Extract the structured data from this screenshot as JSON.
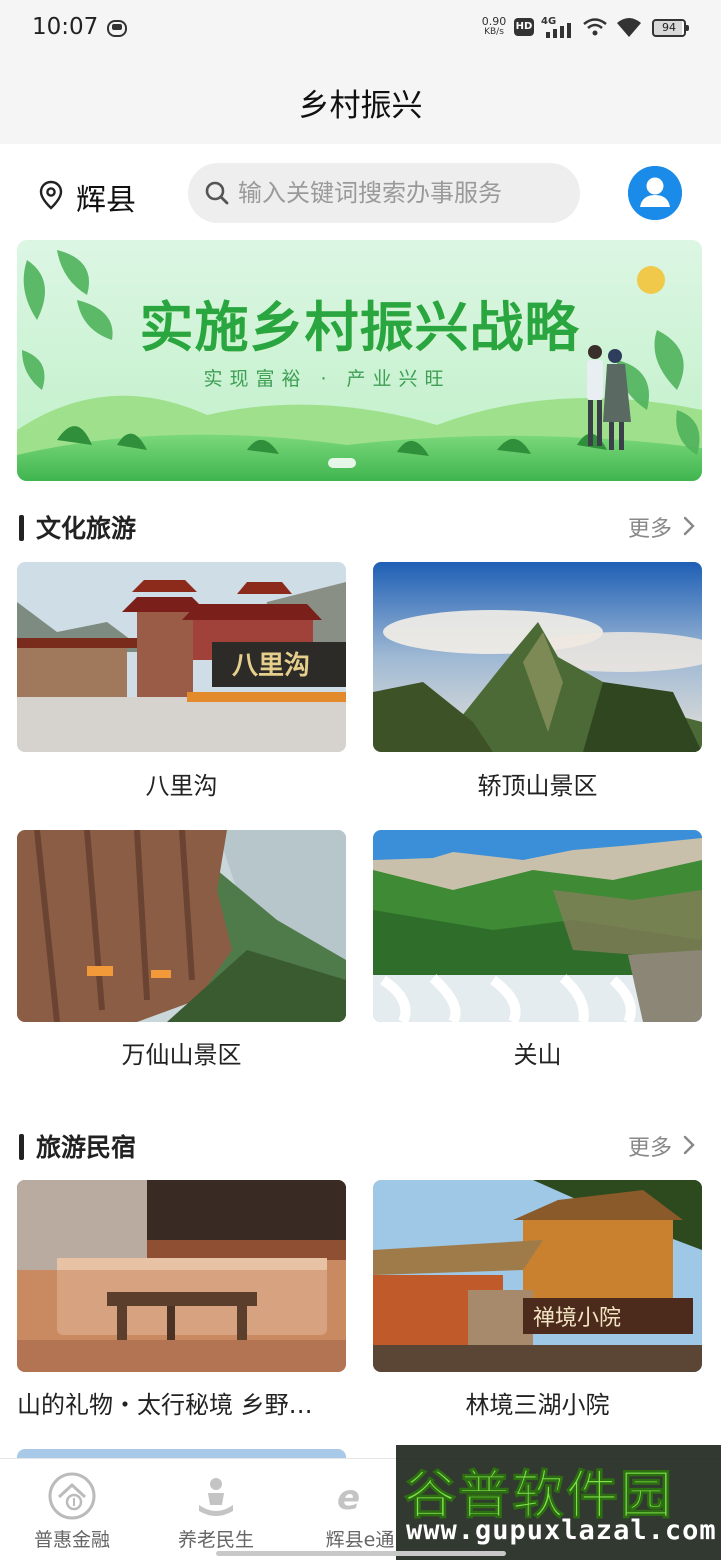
{
  "status": {
    "time": "10:07",
    "speed_value": "0.90",
    "speed_unit": "KB/s",
    "hd": "HD",
    "network": "4G",
    "battery": "94"
  },
  "header": {
    "title": "乡村振兴"
  },
  "location": {
    "city": "辉县"
  },
  "search": {
    "placeholder": "输入关键词搜索办事服务",
    "value": ""
  },
  "banner": {
    "title": "实施乡村振兴战略",
    "subtitle": "实现富裕 · 产业兴旺"
  },
  "sections": [
    {
      "title": "文化旅游",
      "more": "更多",
      "items": [
        {
          "label": "八里沟"
        },
        {
          "label": "轿顶山景区"
        },
        {
          "label": "万仙山景区"
        },
        {
          "label": "关山"
        }
      ]
    },
    {
      "title": "旅游民宿",
      "more": "更多",
      "items": [
        {
          "label": "山的礼物・太行秘境 乡野…"
        },
        {
          "label": "林境三湖小院"
        }
      ]
    }
  ],
  "photo_text": {
    "gate_sign": "八里沟",
    "inn_sign": "禅境小院"
  },
  "bottom_nav": [
    {
      "label": "普惠金融",
      "icon": "finance-icon"
    },
    {
      "label": "养老民生",
      "icon": "elder-care-icon"
    },
    {
      "label": "辉县e通",
      "icon": "huixian-e-icon"
    }
  ],
  "watermark": {
    "text": "谷普软件园",
    "url": "www.gupuxlazal.com"
  },
  "colors": {
    "accent": "#1a8be8",
    "banner_green": "#2aa640",
    "watermark_green": "#7ee04a"
  }
}
